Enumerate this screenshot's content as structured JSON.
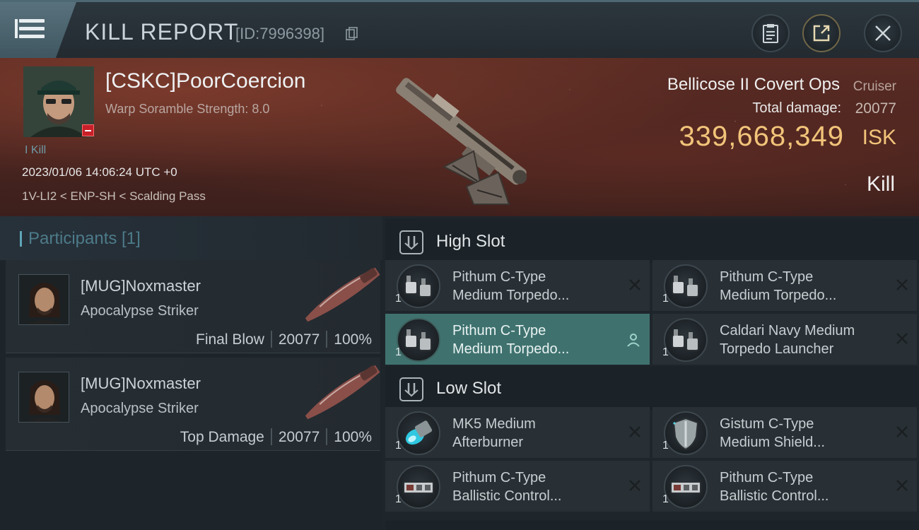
{
  "header": {
    "title": "KILL REPORT",
    "report_id": "[ID:7996398]",
    "icons": [
      "menu-icon",
      "copy-icon",
      "clipboard-icon",
      "share-icon",
      "close-icon"
    ]
  },
  "victim": {
    "name": "[CSKC]PoorCoercion",
    "warp_scramble": "Warp Soramble Strength: 8.0",
    "kill_count": "I Kill",
    "datetime": "2023/01/06 14:06:24 UTC +0",
    "location": "1V-LI2 < ENP-SH < Scalding Pass",
    "ship_name": "Bellicose II Covert Ops",
    "ship_class": "Cruiser",
    "total_damage_label": "Total damage:",
    "total_damage": "20077",
    "isk_value": "339,668,349",
    "isk_unit": "ISK",
    "result": "Kill"
  },
  "participants": {
    "title": "Participants [1]",
    "rows": [
      {
        "name": "[MUG]Noxmaster",
        "ship": "Apocalypse Striker",
        "role": "Final Blow",
        "damage": "20077",
        "percent": "100%"
      },
      {
        "name": "[MUG]Noxmaster",
        "ship": "Apocalypse Striker",
        "role": "Top Damage",
        "damage": "20077",
        "percent": "100%"
      }
    ]
  },
  "fitting": {
    "high_slot": {
      "title": "High Slot",
      "modules": [
        {
          "qty": "1",
          "name": "Pithum C-Type\nMedium Torpedo...",
          "icon": "torpedo-launcher-icon"
        },
        {
          "qty": "1",
          "name": "Pithum C-Type\nMedium Torpedo...",
          "icon": "torpedo-launcher-icon"
        },
        {
          "qty": "1",
          "name": "Pithum C-Type\nMedium Torpedo...",
          "icon": "torpedo-launcher-icon",
          "selected": true
        },
        {
          "qty": "1",
          "name": "Caldari Navy Medium\nTorpedo Launcher",
          "icon": "torpedo-launcher-icon"
        }
      ]
    },
    "low_slot": {
      "title": "Low Slot",
      "modules": [
        {
          "qty": "1",
          "name": "MK5 Medium\nAfterburner",
          "icon": "afterburner-icon"
        },
        {
          "qty": "1",
          "name": "Gistum C-Type\nMedium Shield...",
          "icon": "shield-icon"
        },
        {
          "qty": "1",
          "name": "Pithum C-Type\nBallistic Control...",
          "icon": "ballistic-control-icon"
        },
        {
          "qty": "1",
          "name": "Pithum C-Type\nBallistic Control...",
          "icon": "ballistic-control-icon"
        }
      ]
    }
  },
  "colors": {
    "accent_teal": "#3f726f",
    "isk_gold": "#f2c47a",
    "participants_blue": "#4d7b8a",
    "hero_red": "#5b2c24"
  }
}
